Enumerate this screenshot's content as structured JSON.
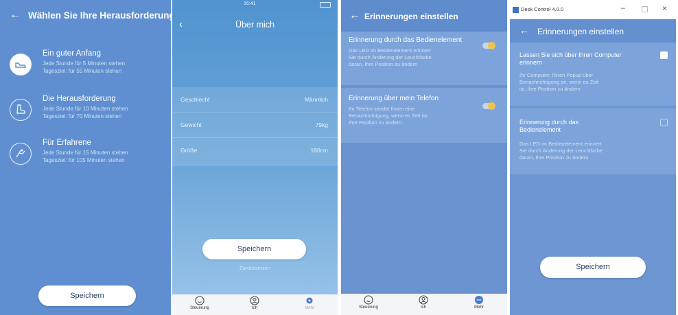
{
  "panel1": {
    "title": "Wählen Sie Ihre Herausforderung",
    "challenges": [
      {
        "title": "Ein guter Anfang",
        "line1": "Jede Stunde für 5 Minuten stehen",
        "line2": "Tagesziel: für 55 Minuten stehen",
        "selected": true
      },
      {
        "title": "Die Herausforderung",
        "line1": "Jede Stunde für 10 Minuten stehen",
        "line2": "Tagesziel: für 70 Minuten stehen",
        "selected": false
      },
      {
        "title": "Für Erfahrene",
        "line1": "Jede Stunde für 15 Minuten stehen",
        "line2": "Tagesziel: für 105 Minuten stehen",
        "selected": false
      }
    ],
    "save": "Speichern"
  },
  "panel2": {
    "time": "16:41",
    "title": "Über mich",
    "rows": [
      {
        "label": "Geschlecht",
        "value": "Männlich"
      },
      {
        "label": "Gewicht",
        "value": "79kg"
      },
      {
        "label": "Größe",
        "value": "180cm"
      }
    ],
    "save": "Speichern",
    "link": "Zurücksetzen"
  },
  "panel3": {
    "title": "Erinnerungen einstellen",
    "sections": [
      {
        "title": "Erinnerung durch das Bedienelement",
        "l1": "Das LED im Bedienelement erinnert",
        "l2": "Sie durch Änderung der Leuchtfarbe",
        "l3": "daran, Ihre Position zu ändern"
      },
      {
        "title": "Erinnerung über mein Telefon",
        "l1": "Ihr Telefon sendet Ihnen eine",
        "l2": "Benachrichtigung, wenn es Zeit ist,",
        "l3": "Ihre Position zu ändern"
      }
    ]
  },
  "tabs": {
    "control": "Steuerung",
    "me": "Ich",
    "more": "Mehr"
  },
  "panel4": {
    "app": "Desk Control 4.0.0",
    "title": "Erinnerungen einstellen",
    "items": [
      {
        "title1": "Lassen Sie sich über Ihren Computer",
        "title2": "erinnern",
        "l1": "Ihr Computer, Ihnen Popup über",
        "l2": "Benachrichtigung an, wenn es Zeit",
        "l3": "ist, Ihre Position zu ändern",
        "checked": true
      },
      {
        "title1": "Erinnerung durch das",
        "title2": "Bedienelement",
        "l1": "Das LED im Bedienelement erinnert",
        "l2": "Sie durch Änderung der Leuchtfarbe",
        "l3": "daran, Ihre Position zu ändern",
        "checked": false
      }
    ],
    "save": "Speichern"
  },
  "colors": {
    "accent": "#5f8fd0",
    "toggle": "#f0c34c",
    "active_tab": "#4a78c8"
  }
}
